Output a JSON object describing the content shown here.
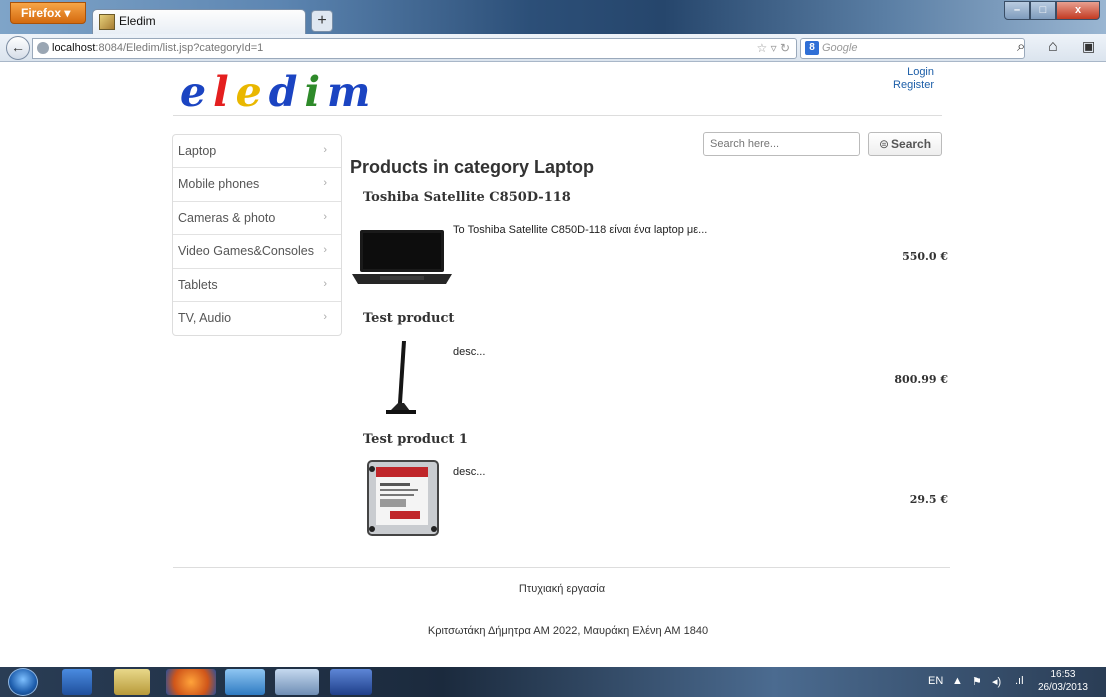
{
  "browser": {
    "menu_label": "Firefox ▾",
    "tab_title": "Eledim",
    "new_tab": "+",
    "url_host": "localhost",
    "url_path": ":8084/Eledim/list.jsp?categoryId=1",
    "search_engine": "Google"
  },
  "header": {
    "logo_letters": [
      "e",
      "l",
      "e",
      "d",
      "i",
      "m"
    ],
    "login": "Login",
    "register": "Register"
  },
  "search": {
    "placeholder": "Search here...",
    "button_label": "Search"
  },
  "sidebar": {
    "items": [
      {
        "label": "Laptop"
      },
      {
        "label": "Mobile phones"
      },
      {
        "label": "Cameras & photo"
      },
      {
        "label": "Video Games&Consoles"
      },
      {
        "label": "Tablets"
      },
      {
        "label": "TV, Audio"
      }
    ],
    "chevron": "›"
  },
  "main": {
    "title": "Products in category Laptop",
    "products": [
      {
        "name": "Toshiba Satellite C850D-118",
        "description": "Το Toshiba Satellite C850D-118 είναι ένα laptop με...",
        "price": "550.0 €",
        "image": "laptop-image"
      },
      {
        "name": "Test product",
        "description": "desc...",
        "price": "800.99 €",
        "image": "monitor-image"
      },
      {
        "name": "Test product 1",
        "description": "desc...",
        "price": "29.5 €",
        "image": "hard-drive-image"
      }
    ]
  },
  "footer": {
    "line1": "Πτυχιακή εργασία",
    "line2": "Κριτσωτάκη Δήμητρα ΑΜ 2022, Μαυράκη Ελένη ΑΜ 1840"
  },
  "taskbar": {
    "language": "EN",
    "time": "16:53",
    "date": "26/03/2013"
  }
}
